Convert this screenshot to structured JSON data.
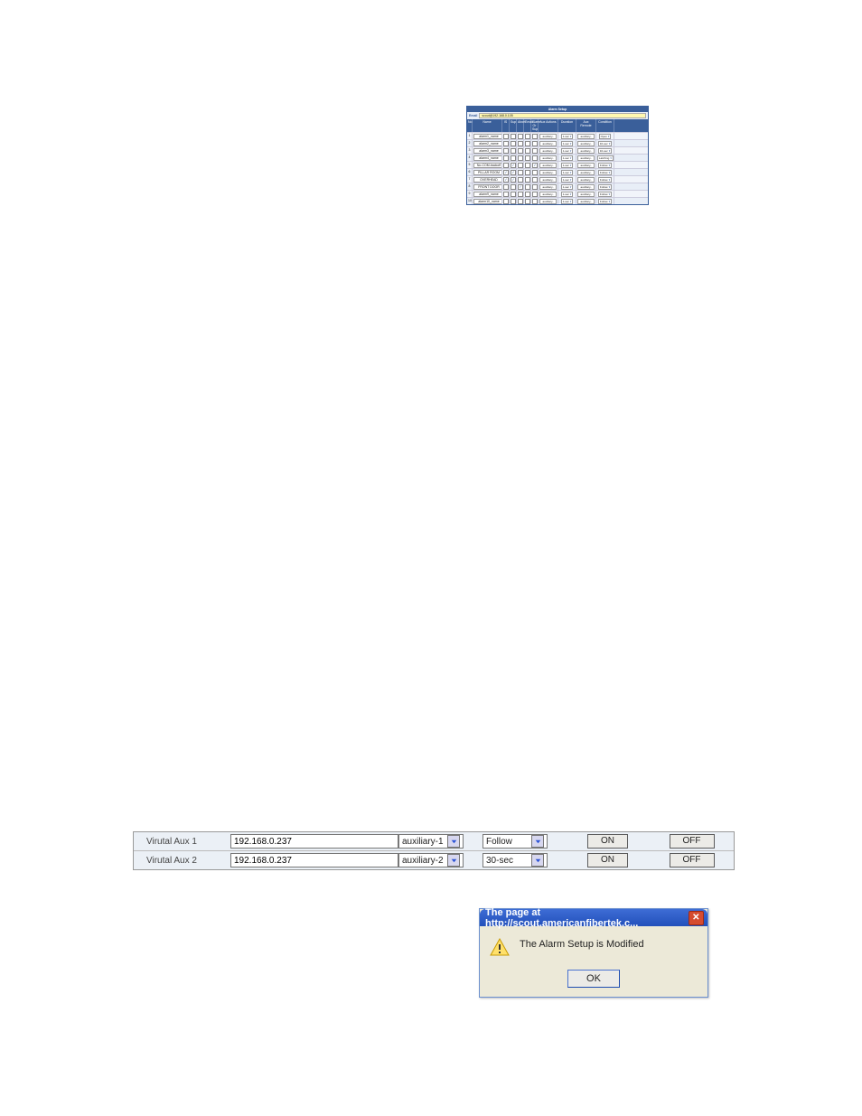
{
  "alarm": {
    "title": "Alarm Setup",
    "email_label": "Email",
    "email_value": "scout@192.168.0.105",
    "headers": [
      "No",
      "Name",
      "IS",
      "Sup",
      "Abort",
      "Email",
      "Alarm Or Sup",
      "Aux Actions",
      "Duration",
      "Aux Remote",
      "Condition"
    ],
    "rows": [
      {
        "no": "1",
        "name": "alarm1_name",
        "is": false,
        "sup": false,
        "abort": false,
        "email": false,
        "aos": false,
        "aux": "auxiliary-1",
        "dur": "1-sec",
        "rem": "auxiliary-1",
        "cond": "Open"
      },
      {
        "no": "2",
        "name": "alarm2_name",
        "is": false,
        "sup": false,
        "abort": false,
        "email": false,
        "aos": false,
        "aux": "auxiliary-1",
        "dur": "1-sec",
        "rem": "auxiliary-1",
        "cond": "10-sec"
      },
      {
        "no": "3",
        "name": "alarm3_name",
        "is": false,
        "sup": false,
        "abort": false,
        "email": false,
        "aos": false,
        "aux": "auxiliary-1",
        "dur": "1-sec",
        "rem": "auxiliary-1",
        "cond": "10-sec"
      },
      {
        "no": "4",
        "name": "alarm4_name",
        "is": false,
        "sup": false,
        "abort": false,
        "email": false,
        "aos": false,
        "aux": "auxiliary-1",
        "dur": "1-sec",
        "rem": "auxiliary-1",
        "cond": "Latching"
      },
      {
        "no": "5",
        "name": "No-COM-backoff",
        "is": false,
        "sup": true,
        "abort": false,
        "email": false,
        "aos": true,
        "aux": "auxiliary-1",
        "dur": "1-sec",
        "rem": "auxiliary-1",
        "cond": "Follow"
      },
      {
        "no": "6",
        "name": "PILLAR ROOM DOOR",
        "is": true,
        "sup": true,
        "abort": false,
        "email": false,
        "aos": false,
        "aux": "auxiliary-1",
        "dur": "1-sec",
        "rem": "auxiliary-1",
        "cond": "Follow"
      },
      {
        "no": "7",
        "name": "OVERHEAD DOOR REAR",
        "is": true,
        "sup": true,
        "abort": false,
        "email": false,
        "aos": false,
        "aux": "auxiliary-1",
        "dur": "1-sec",
        "rem": "auxiliary-1",
        "cond": "Follow"
      },
      {
        "no": "8",
        "name": "FRONT DOOR BELL",
        "is": false,
        "sup": false,
        "abort": true,
        "email": false,
        "aos": false,
        "aux": "auxiliary-1",
        "dur": "1-sec",
        "rem": "auxiliary-1",
        "cond": "Follow"
      },
      {
        "no": "9",
        "name": "alarm9_name",
        "is": false,
        "sup": false,
        "abort": false,
        "email": false,
        "aos": false,
        "aux": "auxiliary-1",
        "dur": "1-sec",
        "rem": "auxiliary-1",
        "cond": "Follow"
      },
      {
        "no": "10",
        "name": "alarm10_name",
        "is": false,
        "sup": false,
        "abort": false,
        "email": false,
        "aos": false,
        "aux": "auxiliary-1",
        "dur": "1-sec",
        "rem": "auxiliary-1",
        "cond": "Follow"
      }
    ]
  },
  "aux": {
    "rows": [
      {
        "label": "Virutal Aux 1",
        "ip": "192.168.0.237",
        "aux": "auxiliary-1",
        "dur": "Follow",
        "on": "ON",
        "off": "OFF"
      },
      {
        "label": "Virutal Aux 2",
        "ip": "192.168.0.237",
        "aux": "auxiliary-2",
        "dur": "30-sec",
        "on": "ON",
        "off": "OFF"
      }
    ]
  },
  "dialog": {
    "title": "The page at http://scout.americanfibertek.c...",
    "message": "The Alarm Setup is Modified",
    "ok": "OK"
  }
}
